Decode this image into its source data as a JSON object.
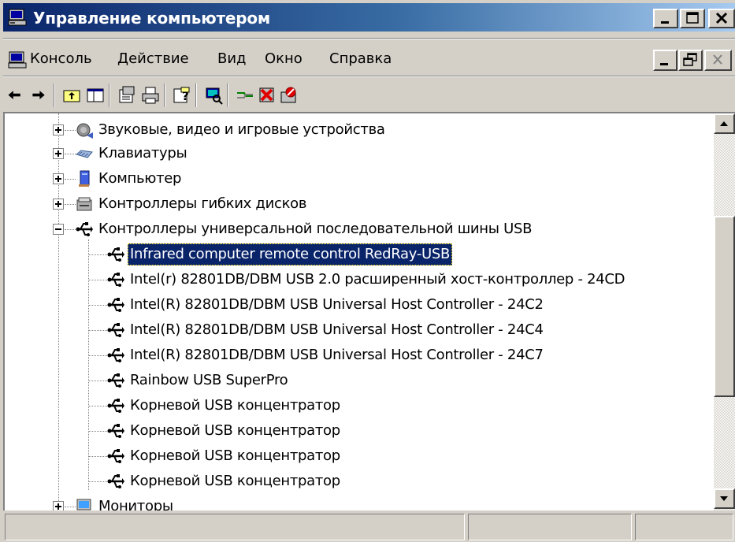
{
  "window": {
    "title": "Управление компьютером",
    "title_icon": "computer-management-icon",
    "buttons": [
      "minimize",
      "maximize",
      "close"
    ]
  },
  "menubar": {
    "icon": "console-icon",
    "items": [
      {
        "label": "Консоль"
      },
      {
        "label": "Действие"
      },
      {
        "label": "Вид"
      },
      {
        "label": "Окно"
      },
      {
        "label": "Справка"
      }
    ]
  },
  "toolbar": {
    "buttons": [
      "back-icon",
      "forward-icon",
      "up-folder-icon",
      "show-hide-tree-icon",
      "properties-icon",
      "print-icon",
      "help-icon",
      "scan-hardware-icon",
      "update-driver-icon",
      "uninstall-icon",
      "disable-icon"
    ]
  },
  "tree": {
    "nodes": [
      {
        "label": "Звуковые, видео и игровые устройства",
        "icon": "sound-icon",
        "expanded": false
      },
      {
        "label": "Клавиатуры",
        "icon": "keyboard-icon",
        "expanded": false
      },
      {
        "label": "Компьютер",
        "icon": "computer-icon",
        "expanded": false
      },
      {
        "label": "Контроллеры гибких дисков",
        "icon": "floppy-controller-icon",
        "expanded": false
      },
      {
        "label": "Контроллеры универсальной последовательной шины USB",
        "icon": "usb-icon",
        "expanded": true
      },
      {
        "label": "Infrared computer remote control RedRay-USB",
        "icon": "usb-icon",
        "selected": true
      },
      {
        "label": "Intel(r) 82801DB/DBM USB 2.0 расширенный хост-контроллер - 24CD",
        "icon": "usb-icon"
      },
      {
        "label": "Intel(R) 82801DB/DBM USB Universal Host Controller - 24C2",
        "icon": "usb-icon"
      },
      {
        "label": "Intel(R) 82801DB/DBM USB Universal Host Controller - 24C4",
        "icon": "usb-icon"
      },
      {
        "label": "Intel(R) 82801DB/DBM USB Universal Host Controller - 24C7",
        "icon": "usb-icon"
      },
      {
        "label": "Rainbow USB SuperPro",
        "icon": "usb-icon"
      },
      {
        "label": "Корневой USB концентратор",
        "icon": "usb-icon"
      },
      {
        "label": "Корневой USB концентратор",
        "icon": "usb-icon"
      },
      {
        "label": "Корневой USB концентратор",
        "icon": "usb-icon"
      },
      {
        "label": "Корневой USB концентратор",
        "icon": "usb-icon"
      },
      {
        "label": "Мониторы",
        "icon": "monitor-icon",
        "expanded": false
      }
    ]
  },
  "statusbar": {
    "panes": [
      "",
      "",
      ""
    ]
  },
  "colors": {
    "titlebar_start": "#0a246a",
    "titlebar_end": "#a6caf0",
    "selection": "#0a246a",
    "face": "#d4d0c8"
  }
}
